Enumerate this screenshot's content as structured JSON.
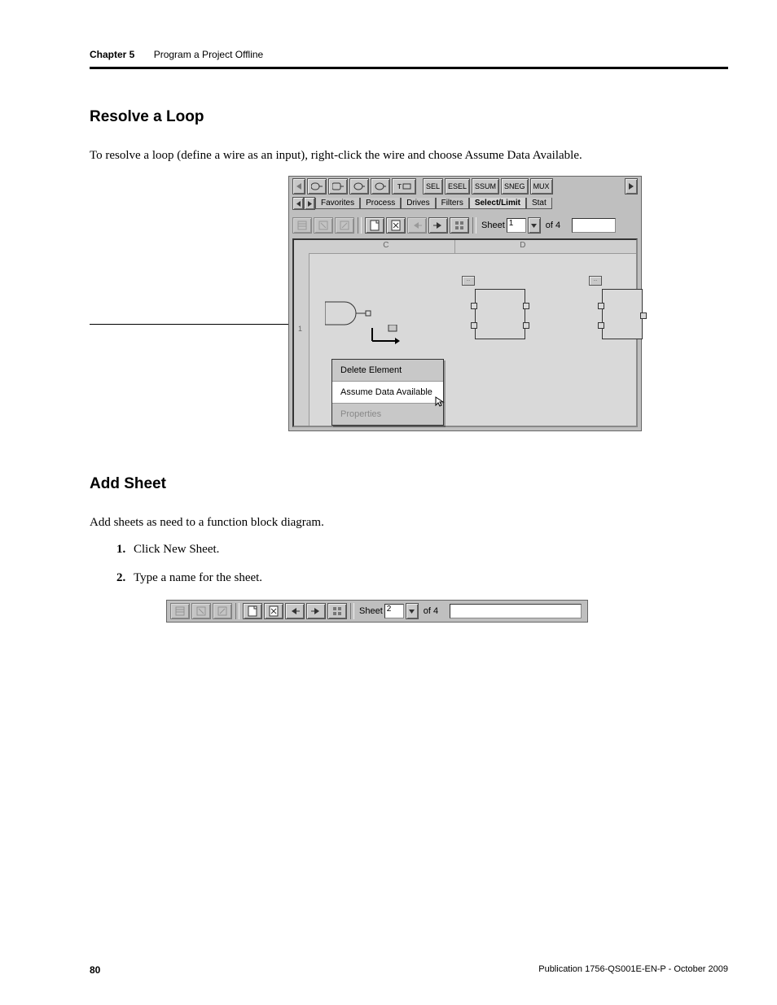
{
  "header": {
    "chapter": "Chapter 5",
    "title": "Program a Project Offline"
  },
  "section1": {
    "heading": "Resolve a Loop",
    "intro": "To resolve a loop (define a wire as an input), right-click the wire and choose Assume Data Available."
  },
  "fig1": {
    "top_buttons": [
      "SEL",
      "ESEL",
      "SSUM",
      "SNEG",
      "MUX"
    ],
    "tabs": [
      "Favorites",
      "Process",
      "Drives",
      "Filters",
      "Select/Limit",
      "Stat"
    ],
    "sheet_label": "Sheet",
    "sheet_value": "1",
    "of_label": "of 4",
    "ruler": {
      "c": "C",
      "d": "D"
    },
    "gutter_label": "1",
    "context_menu": {
      "delete": "Delete Element",
      "assume": "Assume Data Available",
      "properties": "Properties"
    }
  },
  "section2": {
    "heading": "Add Sheet",
    "intro": "Add sheets as need to a function block diagram.",
    "steps": [
      "Click New Sheet.",
      "Type a name for the sheet."
    ]
  },
  "fig2": {
    "sheet_label": "Sheet",
    "sheet_value": "2",
    "of_label": "of 4"
  },
  "footer": {
    "page": "80",
    "pub": "Publication 1756-QS001E-EN-P - October 2009"
  }
}
